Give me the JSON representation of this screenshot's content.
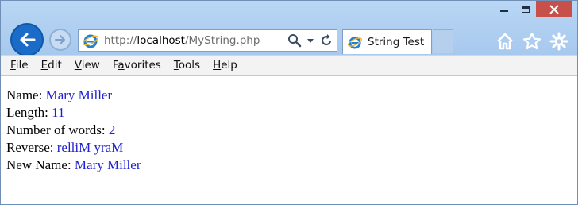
{
  "browser": {
    "address": {
      "prefix": "http://",
      "host": "localhost",
      "path": "/MyString.php"
    },
    "tab": {
      "label": "String Test"
    },
    "menu": [
      {
        "pre": "",
        "u": "F",
        "post": "ile"
      },
      {
        "pre": "",
        "u": "E",
        "post": "dit"
      },
      {
        "pre": "",
        "u": "V",
        "post": "iew"
      },
      {
        "pre": "F",
        "u": "a",
        "post": "vorites"
      },
      {
        "pre": "",
        "u": "T",
        "post": "ools"
      },
      {
        "pre": "",
        "u": "H",
        "post": "elp"
      }
    ],
    "icons": [
      "back-icon",
      "forward-icon",
      "ie-logo-icon",
      "search-icon",
      "dropdown-icon",
      "refresh-icon",
      "home-icon",
      "favorites-star-icon",
      "settings-gear-icon"
    ]
  },
  "page": {
    "name_label": "Name: ",
    "name_value": "Mary Miller",
    "length_label": "Length: ",
    "length_value": "11",
    "words_label": "Number of words: ",
    "words_value": "2",
    "reverse_label": "Reverse: ",
    "reverse_value": "relliM yraM",
    "newname_label": "New Name: ",
    "newname_value": "Mary Miller"
  },
  "colors": {
    "value_text": "#1f20d4",
    "chrome": "#a4c7ee",
    "close_button": "#c7504b"
  }
}
